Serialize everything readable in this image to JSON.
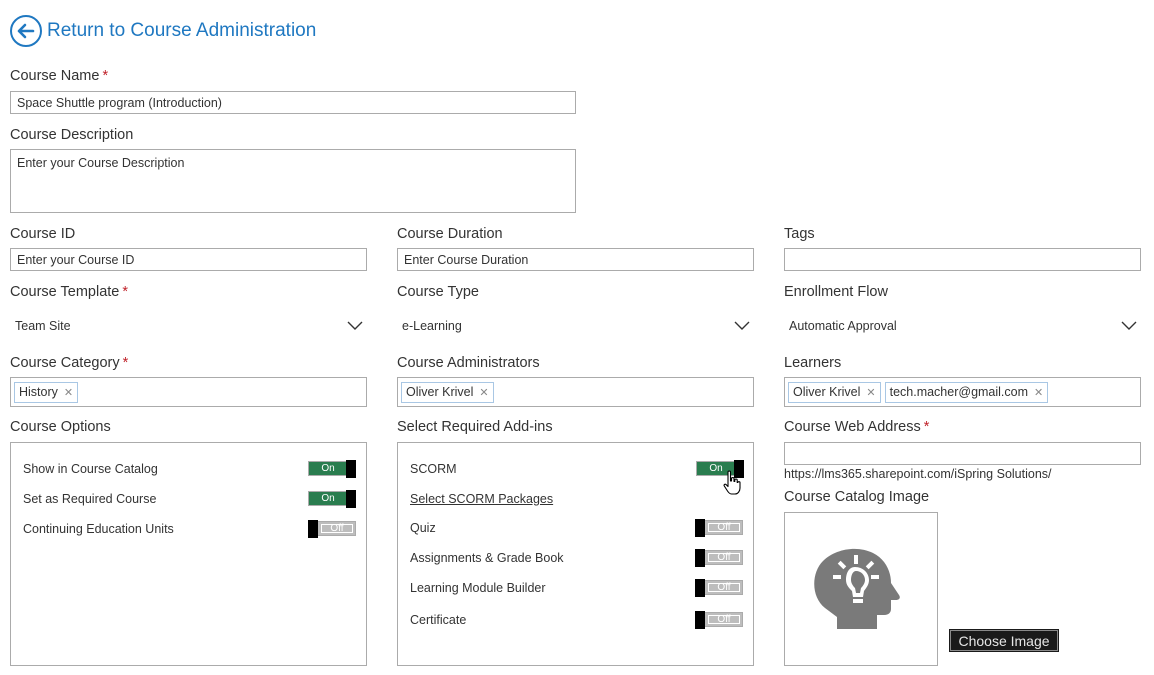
{
  "back_link": {
    "label": "Return to Course Administration"
  },
  "course_name": {
    "label": "Course Name",
    "value": "Space Shuttle program (Introduction)"
  },
  "course_description": {
    "label": "Course Description",
    "placeholder": "Enter your Course Description"
  },
  "course_id": {
    "label": "Course ID",
    "placeholder": "Enter your Course ID"
  },
  "course_duration": {
    "label": "Course Duration",
    "placeholder": "Enter Course Duration"
  },
  "tags": {
    "label": "Tags",
    "value": ""
  },
  "course_template": {
    "label": "Course Template",
    "value": "Team Site"
  },
  "course_type": {
    "label": "Course Type",
    "value": "e-Learning"
  },
  "enrollment_flow": {
    "label": "Enrollment Flow",
    "value": "Automatic Approval"
  },
  "course_category": {
    "label": "Course Category",
    "tags": [
      "History"
    ]
  },
  "course_administrators": {
    "label": "Course Administrators",
    "tags": [
      "Oliver Krivel"
    ]
  },
  "learners": {
    "label": "Learners",
    "tags": [
      "Oliver Krivel",
      "tech.macher@gmail.com"
    ]
  },
  "course_options": {
    "label": "Course Options",
    "items": [
      {
        "label": "Show in Course Catalog",
        "state": "On"
      },
      {
        "label": "Set as Required Course",
        "state": "On"
      },
      {
        "label": "Continuing Education Units",
        "state": "Off"
      }
    ]
  },
  "addins": {
    "label": "Select Required Add-ins",
    "scorm": {
      "label": "SCORM",
      "state": "On"
    },
    "scorm_packages_link": "Select SCORM Packages",
    "items": [
      {
        "label": "Quiz",
        "state": "Off"
      },
      {
        "label": "Assignments & Grade Book",
        "state": "Off"
      },
      {
        "label": "Learning Module Builder",
        "state": "Off"
      },
      {
        "label": "Certificate",
        "state": "Off"
      }
    ]
  },
  "web_address": {
    "label": "Course Web Address",
    "value": "",
    "url_hint": "https://lms365.sharepoint.com/iSpring Solutions/"
  },
  "catalog_image": {
    "label": "Course Catalog Image",
    "button": "Choose Image"
  },
  "required_mark": "*",
  "colors": {
    "accent": "#1f78c1",
    "toggle_on": "#2a7d4f",
    "toggle_off": "#bdbdbd",
    "required": "#c0222a"
  },
  "icons": {
    "back": "arrow-left-circle-icon",
    "chevron": "chevron-down-icon",
    "remove": "close-icon",
    "image": "head-lightbulb-icon",
    "cursor": "hand-pointer-icon"
  }
}
